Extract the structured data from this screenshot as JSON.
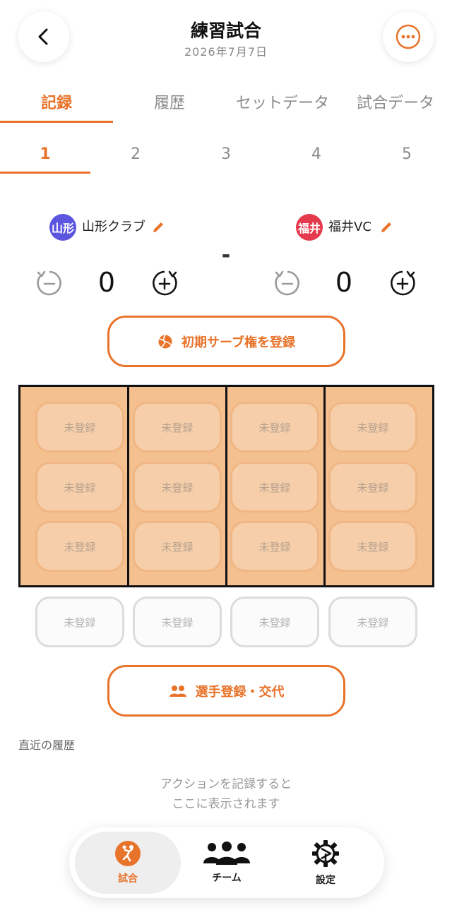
{
  "header": {
    "title": "練習試合",
    "date": "2026年7月7日"
  },
  "tabs": [
    {
      "label": "記録",
      "active": true
    },
    {
      "label": "履歴",
      "active": false
    },
    {
      "label": "セットデータ",
      "active": false
    },
    {
      "label": "試合データ",
      "active": false
    }
  ],
  "sets": [
    {
      "label": "1",
      "active": true
    },
    {
      "label": "2",
      "active": false
    },
    {
      "label": "3",
      "active": false
    },
    {
      "label": "4",
      "active": false
    },
    {
      "label": "5",
      "active": false
    }
  ],
  "teams": {
    "home": {
      "badge": "山形",
      "name": "山形クラブ",
      "score": "0",
      "color": "#5B55E0"
    },
    "away": {
      "badge": "福井",
      "name": "福井VC",
      "score": "0",
      "color": "#E5394E"
    },
    "separator": "-"
  },
  "serve_button": {
    "label": "初期サーブ権を登録"
  },
  "court": {
    "slot_label": "未登録",
    "columns": 4,
    "rows": 3
  },
  "bench": {
    "slot_label": "未登録",
    "count": 4
  },
  "substitute_button": {
    "label": "選手登録・交代"
  },
  "history": {
    "title": "直近の履歴",
    "empty_line1": "アクションを記録すると",
    "empty_line2": "ここに表示されます"
  },
  "bottom_nav": [
    {
      "label": "試合",
      "icon": "volleyball-player-icon",
      "active": true
    },
    {
      "label": "チーム",
      "icon": "team-icon",
      "active": false
    },
    {
      "label": "設定",
      "icon": "gear-icon",
      "active": false
    }
  ],
  "colors": {
    "accent": "#E8732A",
    "court": "#F5C08F"
  }
}
